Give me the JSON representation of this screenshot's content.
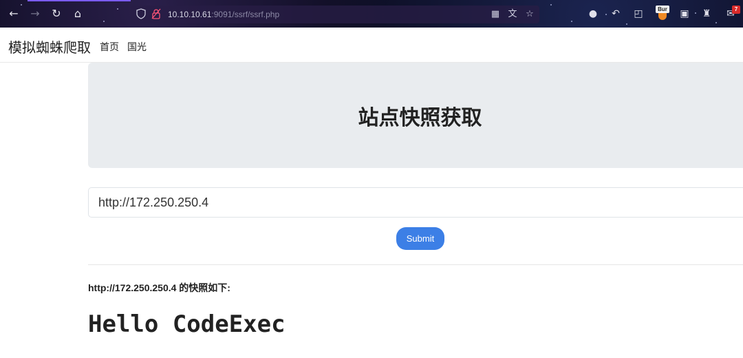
{
  "browser": {
    "url_host": "10.10.10.61",
    "url_rest": ":9091/ssrf/ssrf.php",
    "burp_label": "Bur",
    "notification_count": "7"
  },
  "site": {
    "brand": "模拟蜘蛛爬取",
    "nav": [
      "首页",
      "国光"
    ]
  },
  "jumbotron": {
    "title": "站点快照获取"
  },
  "form": {
    "url_value": "http://172.250.250.4",
    "submit_label": "Submit"
  },
  "result": {
    "heading": "http://172.250.250.4 的快照如下:",
    "body": "Hello CodeExec"
  }
}
